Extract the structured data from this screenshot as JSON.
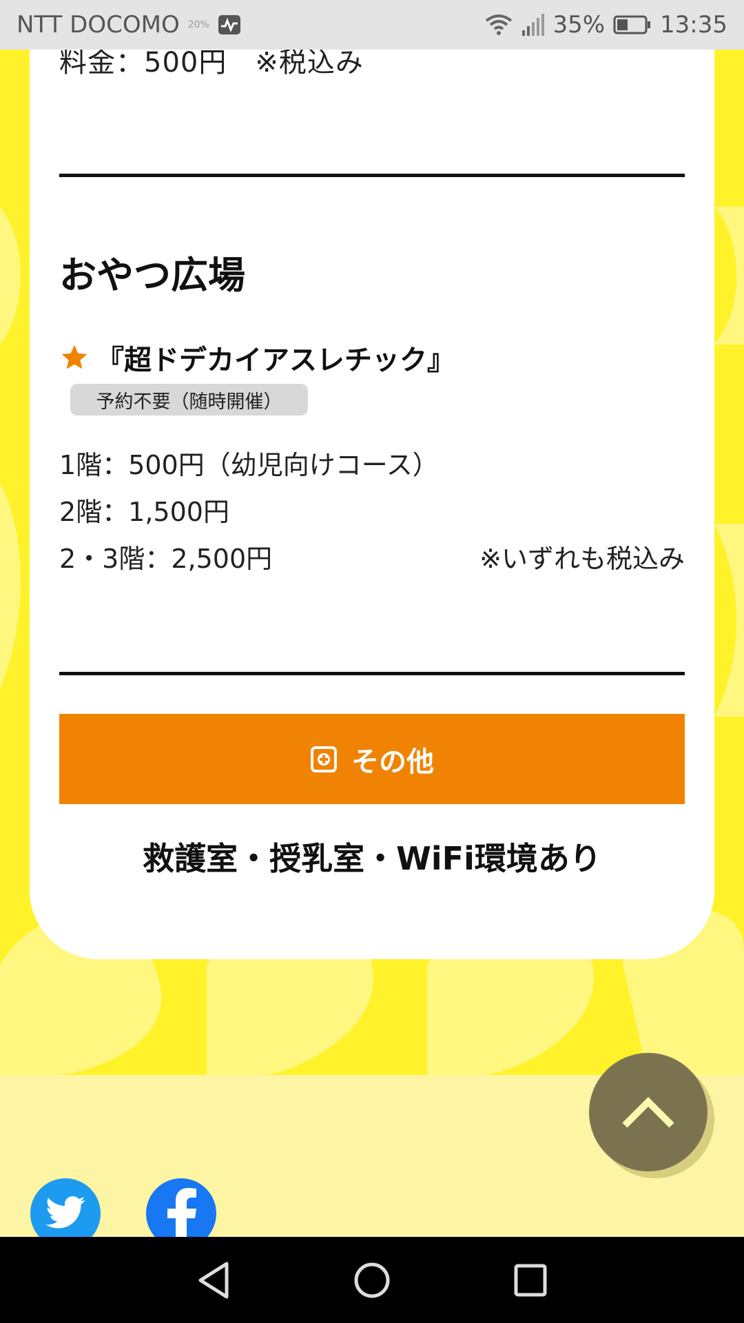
{
  "status_bar": {
    "carrier": "NTT DOCOMO",
    "weather_percent": "20%",
    "battery": "35%",
    "time": "13:35"
  },
  "content": {
    "price_line": "料金：500円　※税込み",
    "section_title": "おやつ広場",
    "item_title": "『超ドデカイアスレチック』",
    "badge": "予約不要（随時開催）",
    "prices": [
      "1階：500円（幼児向けコース）",
      "2階：1,500円",
      "2・3階：2,500円"
    ],
    "tax_note": "※いずれも税込み",
    "other_button_label": "その他",
    "amenities": "救護室・授乳室・WiFi環境あり"
  },
  "colors": {
    "accent": "#f08303",
    "background": "#fff22b"
  }
}
